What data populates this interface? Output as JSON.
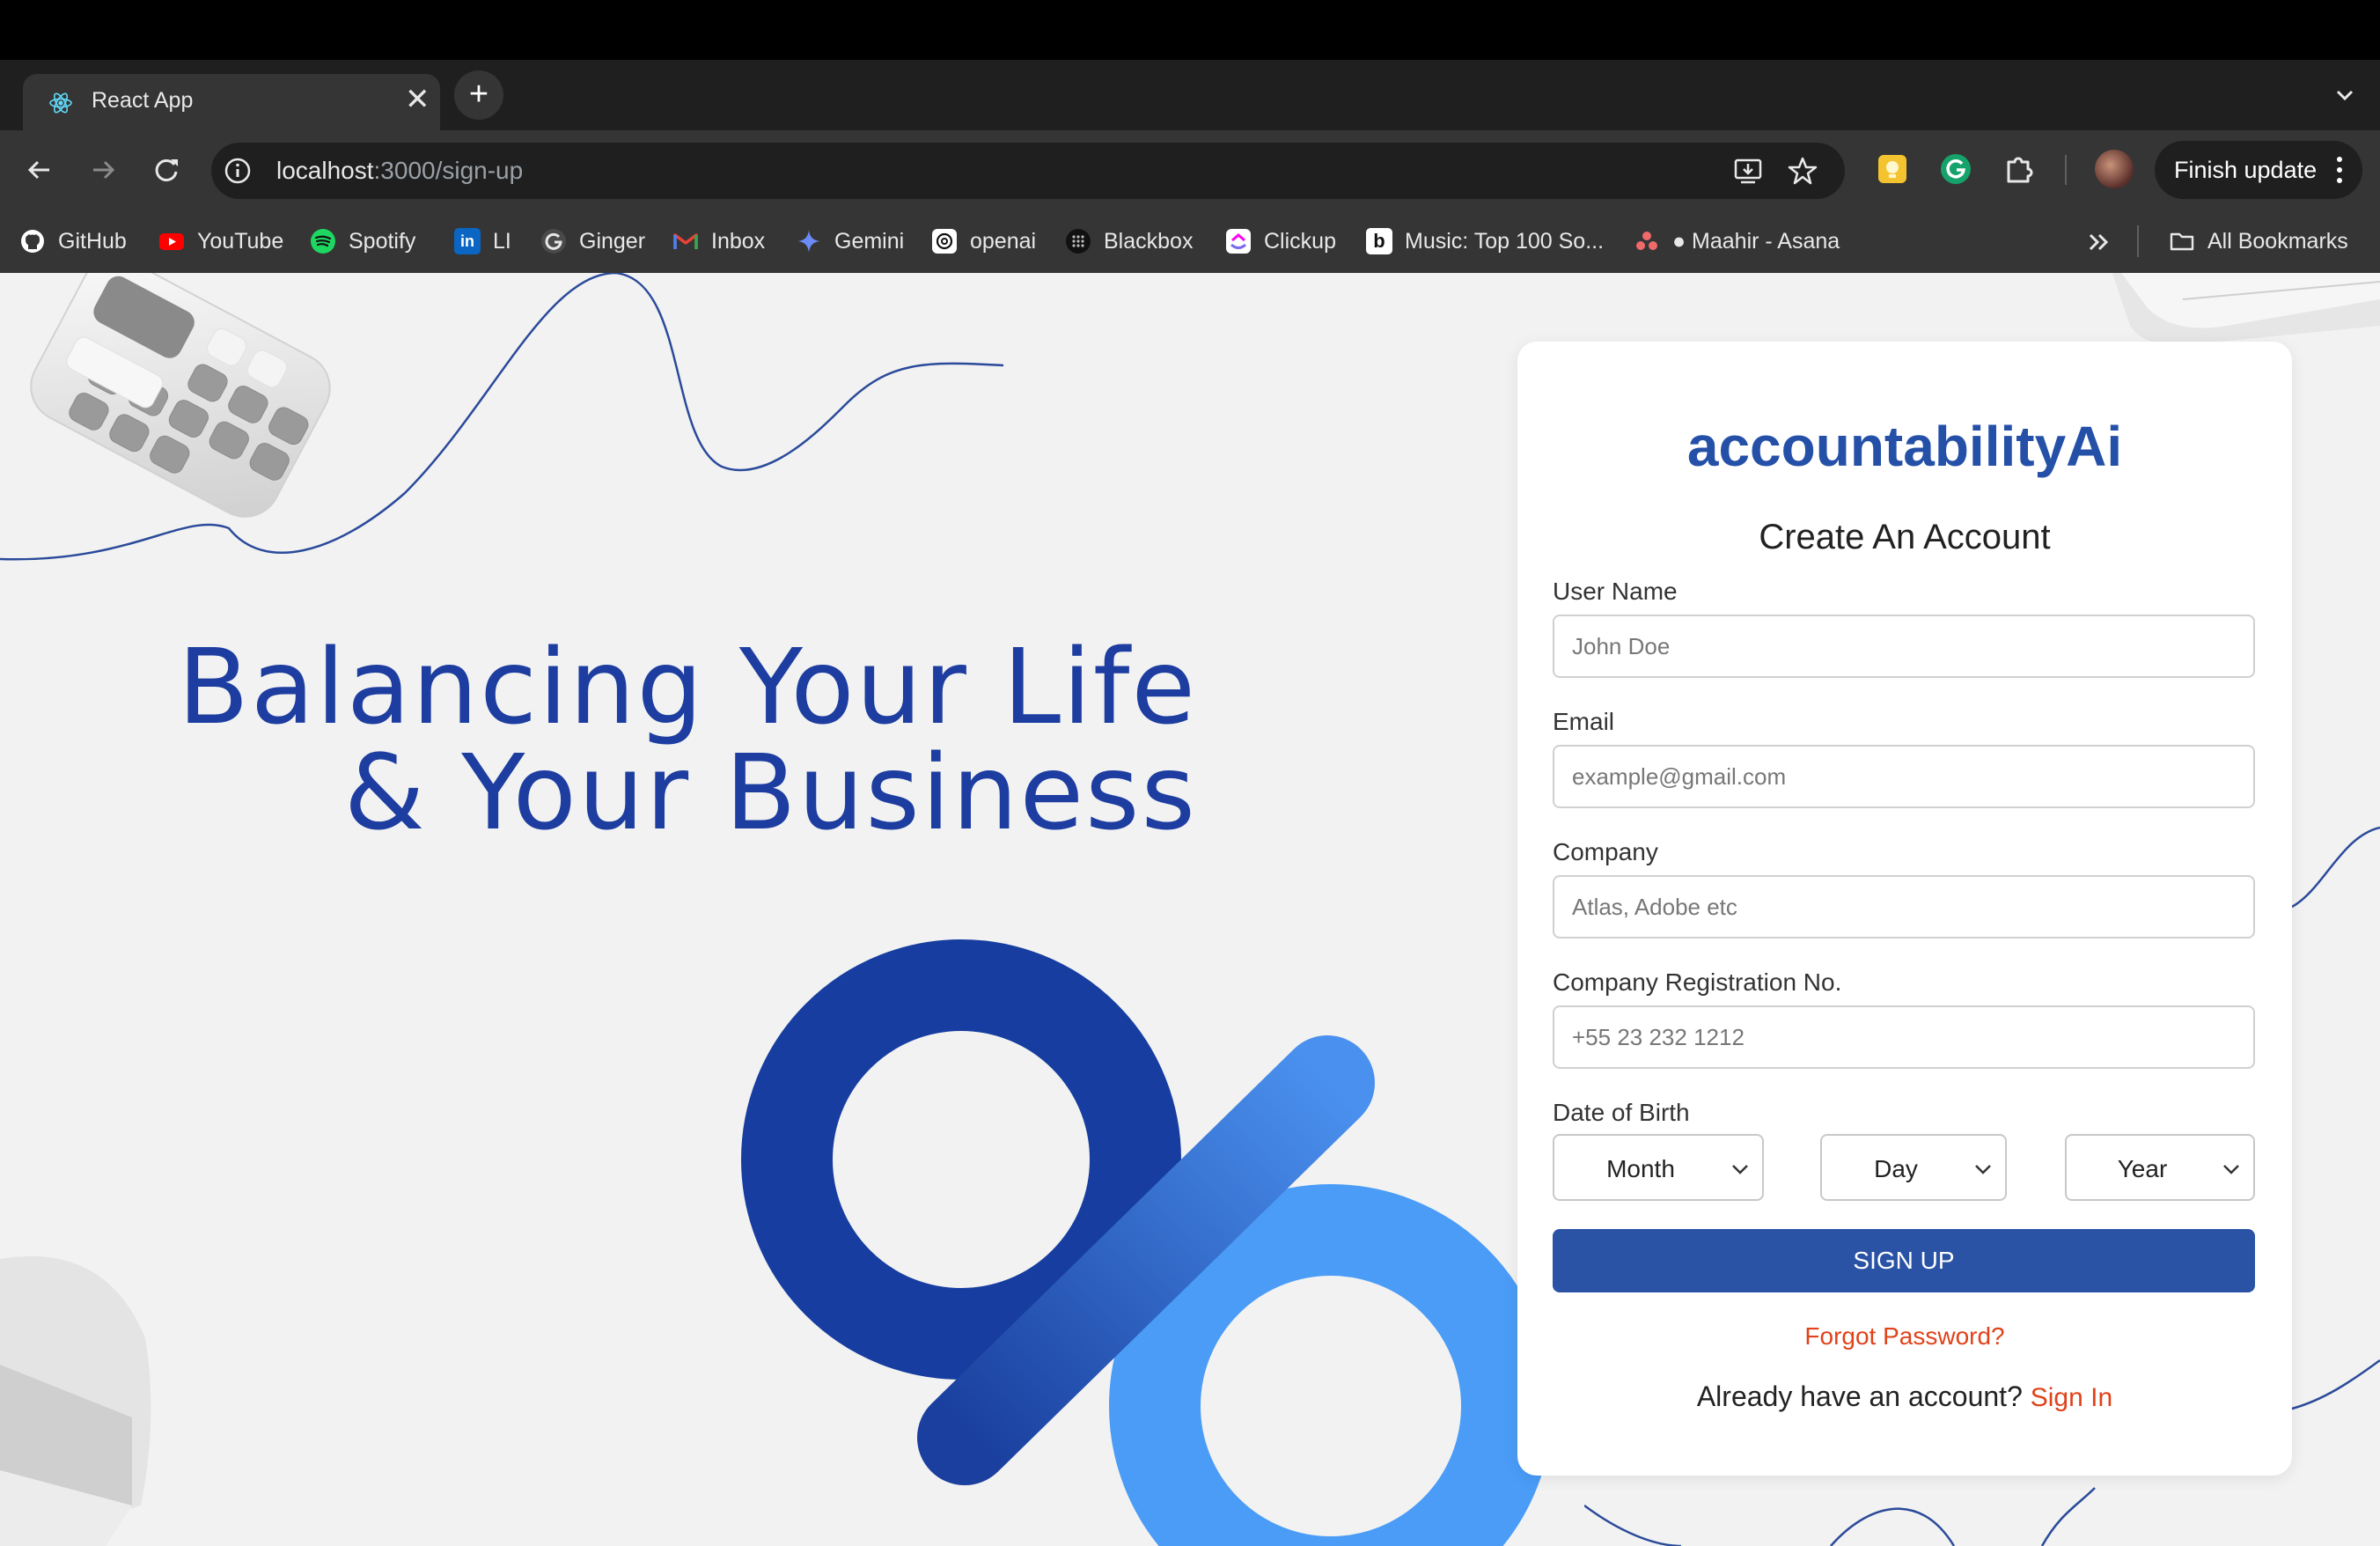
{
  "browser": {
    "tab": {
      "title": "React App",
      "close_glyph": "✕"
    },
    "new_tab_glyph": "+",
    "address": {
      "host": "localhost",
      "path": ":3000/sign-up"
    },
    "finish_update_label": "Finish update",
    "bookmarks": [
      {
        "label": "GitHub",
        "icon": "github-icon"
      },
      {
        "label": "YouTube",
        "icon": "youtube-icon"
      },
      {
        "label": "Spotify",
        "icon": "spotify-icon"
      },
      {
        "label": "LI",
        "icon": "linkedin-icon"
      },
      {
        "label": "Ginger",
        "icon": "ginger-icon"
      },
      {
        "label": "Inbox",
        "icon": "gmail-icon"
      },
      {
        "label": "Gemini",
        "icon": "gemini-icon"
      },
      {
        "label": "openai",
        "icon": "openai-icon"
      },
      {
        "label": "Blackbox",
        "icon": "blackbox-icon"
      },
      {
        "label": "Clickup",
        "icon": "clickup-icon"
      },
      {
        "label": "Music: Top 100 So...",
        "icon": "music-b-icon"
      },
      {
        "label": "● Maahir - Asana",
        "icon": "asana-icon"
      }
    ],
    "all_bookmarks_label": "All Bookmarks"
  },
  "hero": {
    "line1": "Balancing Your Life",
    "line2": "& Your Business"
  },
  "form": {
    "brand": "accountabilityAi",
    "title": "Create An Account",
    "fields": [
      {
        "label": "User Name",
        "placeholder": "John Doe"
      },
      {
        "label": "Email",
        "placeholder": "example@gmail.com"
      },
      {
        "label": "Company",
        "placeholder": "Atlas, Adobe etc"
      },
      {
        "label": "Company Registration No.",
        "placeholder": "+55 23 232 1212"
      }
    ],
    "dob": {
      "label": "Date of Birth",
      "month": "Month",
      "day": "Day",
      "year": "Year"
    },
    "submit_label": "SIGN UP",
    "forgot_label": "Forgot Password?",
    "already_text": "Already have an account?",
    "signin_label": "Sign In"
  },
  "colors": {
    "brand_blue": "#2550a8",
    "hero_blue": "#1d3ea0",
    "accent_orange": "#e0421a",
    "button_blue": "#2a53a6"
  }
}
